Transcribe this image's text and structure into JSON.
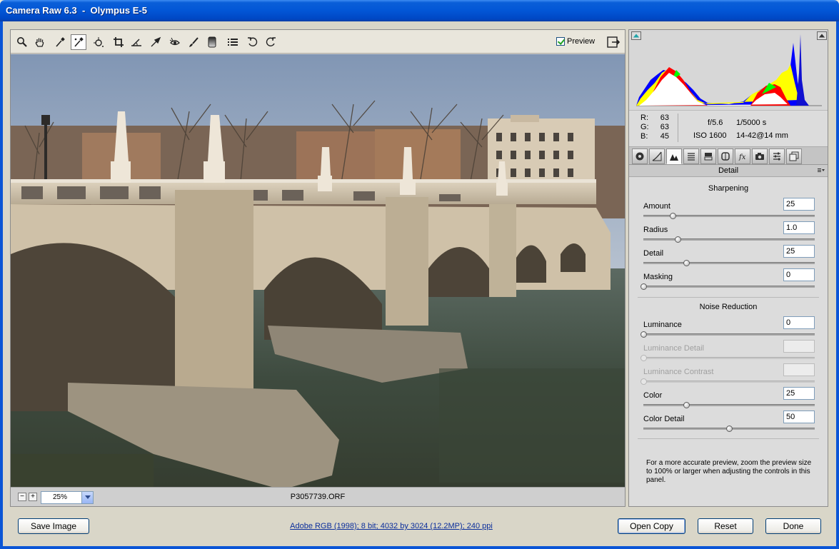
{
  "window": {
    "title": "Camera Raw 6.3  -  Olympus E-5"
  },
  "toolbar": {
    "tools": [
      "zoom-tool",
      "hand-tool",
      "white-balance-tool",
      "color-sampler-tool",
      "targeted-adjustment-tool",
      "crop-tool",
      "straighten-tool",
      "spot-removal-tool",
      "red-eye-removal-tool",
      "adjustment-brush-tool",
      "graduated-filter-tool",
      "preferences-tool",
      "rotate-left-tool",
      "rotate-right-tool"
    ],
    "active_tool": "color-sampler-tool",
    "preview_label": "Preview",
    "preview_checked": true
  },
  "status": {
    "zoom_minus": "−",
    "zoom_plus": "+",
    "zoom_value": "25%",
    "filename": "P3057739.ORF"
  },
  "readout": {
    "r_label": "R:",
    "r_value": "63",
    "g_label": "G:",
    "g_value": "63",
    "b_label": "B:",
    "b_value": "45",
    "aperture": "f/5.6",
    "shutter": "1/5000 s",
    "iso": "ISO 1600",
    "lens": "14-42@14 mm"
  },
  "panel": {
    "title": "Detail",
    "sharpening_title": "Sharpening",
    "noise_title": "Noise Reduction",
    "amount": {
      "label": "Amount",
      "value": "25",
      "pos": 0.17
    },
    "radius": {
      "label": "Radius",
      "value": "1.0",
      "pos": 0.2
    },
    "detail": {
      "label": "Detail",
      "value": "25",
      "pos": 0.25
    },
    "masking": {
      "label": "Masking",
      "value": "0",
      "pos": 0.0
    },
    "luminance": {
      "label": "Luminance",
      "value": "0",
      "pos": 0.0
    },
    "luminance_detail": {
      "label": "Luminance Detail",
      "value": "",
      "pos": 0.0
    },
    "luminance_contrast": {
      "label": "Luminance Contrast",
      "value": "",
      "pos": 0.0
    },
    "color": {
      "label": "Color",
      "value": "25",
      "pos": 0.25
    },
    "color_detail": {
      "label": "Color Detail",
      "value": "50",
      "pos": 0.5
    },
    "note": "For a more accurate preview, zoom the preview size to 100% or larger when adjusting the controls in this panel."
  },
  "bottom": {
    "save_label": "Save Image",
    "workflow_link": "Adobe RGB (1998); 8 bit; 4032 by 3024 (12.2MP); 240 ppi",
    "open_label": "Open Copy",
    "reset_label": "Reset",
    "done_label": "Done"
  }
}
